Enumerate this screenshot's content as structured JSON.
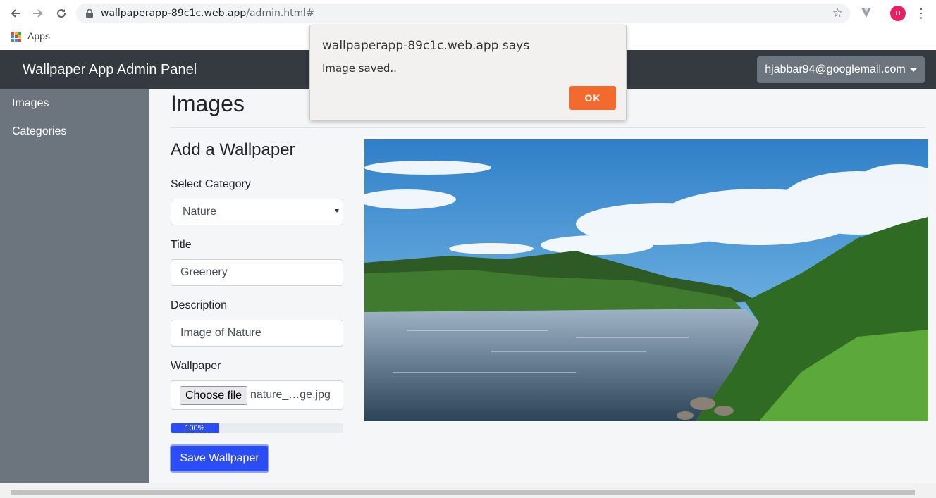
{
  "browser": {
    "url_host": "wallpaperapp-89c1c.web.app",
    "url_path": "/admin.html#",
    "bookmarks_apps_label": "Apps",
    "profile_initial": "H"
  },
  "navbar": {
    "brand": "Wallpaper App Admin Panel",
    "user_email": "hjabbar94@googlemail.com"
  },
  "sidebar": {
    "items": [
      {
        "label": "Images"
      },
      {
        "label": "Categories"
      }
    ]
  },
  "main": {
    "title": "Images",
    "form": {
      "heading": "Add a Wallpaper",
      "category_label": "Select Category",
      "category_value": "Nature",
      "title_label": "Title",
      "title_value": "Greenery",
      "description_label": "Description",
      "description_value": "Image of Nature",
      "wallpaper_label": "Wallpaper",
      "choose_file_label": "Choose file",
      "file_name": "nature_…ge.jpg",
      "progress_text": "100%",
      "progress_fraction": 0.28,
      "save_label": "Save Wallpaper"
    },
    "preview_image": "river-landscape-photo"
  },
  "dialog": {
    "title": "wallpaperapp-89c1c.web.app says",
    "message": "Image saved..",
    "ok_label": "OK"
  },
  "colors": {
    "navbar": "#343a40",
    "sidebar": "#6c757d",
    "primary": "#2b4df5",
    "dialog_ok": "#f26a2e"
  }
}
